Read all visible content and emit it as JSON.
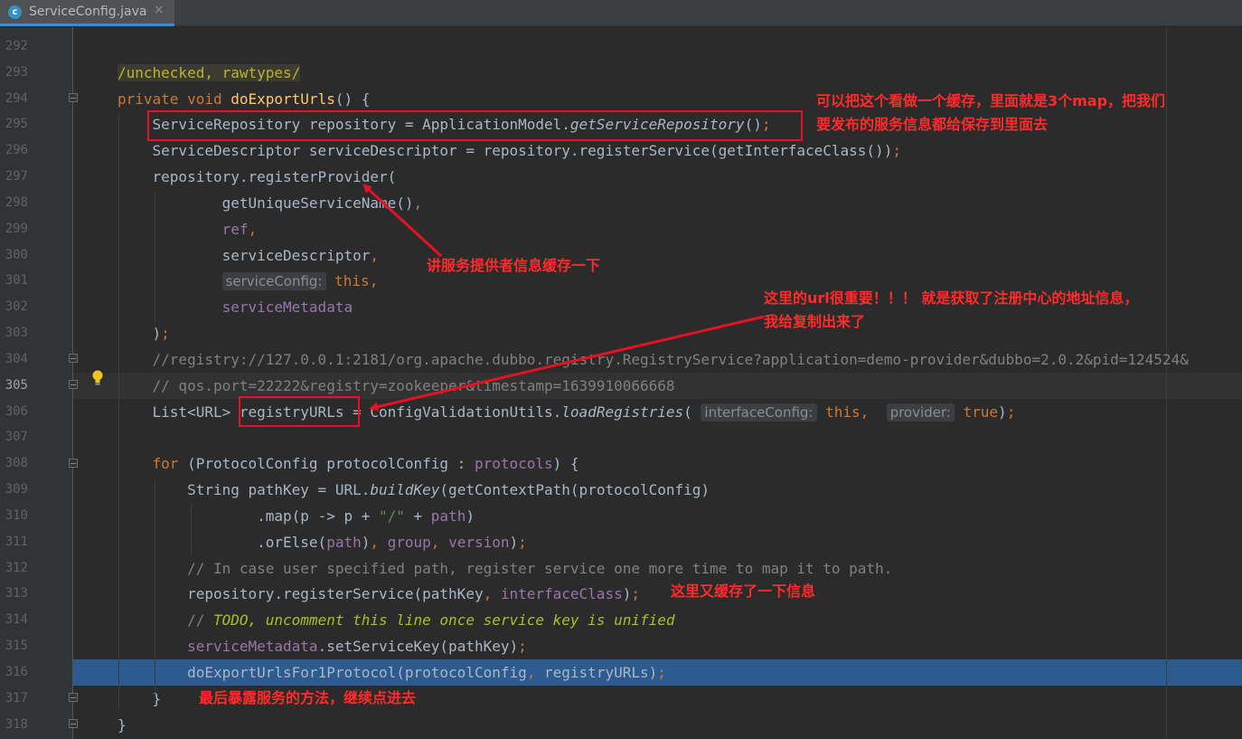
{
  "tab": {
    "icon_letter": "c",
    "name": "ServiceConfig.java",
    "close": "×"
  },
  "lines": [
    {
      "n": "292",
      "segs": []
    },
    {
      "n": "293",
      "segs": [
        {
          "t": "/unchecked, rawtypes/",
          "c": "ann ann-bg"
        }
      ]
    },
    {
      "n": "294",
      "segs": [
        {
          "t": "private void ",
          "c": "k"
        },
        {
          "t": "doExportUrls",
          "c": "m"
        },
        {
          "t": "() {"
        }
      ]
    },
    {
      "n": "295",
      "segs": [
        {
          "t": "    ServiceRepository repository = ApplicationModel."
        },
        {
          "t": "getServiceRepository",
          "c": "i"
        },
        {
          "t": "()"
        },
        {
          "t": ";",
          "c": "k"
        }
      ]
    },
    {
      "n": "296",
      "segs": [
        {
          "t": "    ServiceDescriptor serviceDescriptor = repository.registerService(getInterfaceClass())"
        },
        {
          "t": ";",
          "c": "k"
        }
      ]
    },
    {
      "n": "297",
      "segs": [
        {
          "t": "    repository.registerProvider("
        }
      ]
    },
    {
      "n": "298",
      "segs": [
        {
          "t": "            getUniqueServiceName()"
        },
        {
          "t": ",",
          "c": "k"
        }
      ]
    },
    {
      "n": "299",
      "segs": [
        {
          "t": "            "
        },
        {
          "t": "ref",
          "c": "f"
        },
        {
          "t": ",",
          "c": "k"
        }
      ]
    },
    {
      "n": "300",
      "segs": [
        {
          "t": "            serviceDescriptor"
        },
        {
          "t": ",",
          "c": "k"
        }
      ]
    },
    {
      "n": "301",
      "segs": [
        {
          "t": "            "
        },
        {
          "t": "serviceConfig:",
          "c": "hint"
        },
        {
          "t": " this",
          "c": "k"
        },
        {
          "t": ",",
          "c": "k"
        }
      ]
    },
    {
      "n": "302",
      "segs": [
        {
          "t": "            "
        },
        {
          "t": "serviceMetadata",
          "c": "f"
        }
      ]
    },
    {
      "n": "303",
      "segs": [
        {
          "t": "    )"
        },
        {
          "t": ";",
          "c": "k"
        }
      ]
    },
    {
      "n": "304",
      "segs": [
        {
          "t": "    //registry://127.0.0.1:2181/org.apache.dubbo.registry.RegistryService?application=demo-provider&dubbo=2.0.2&pid=124524&",
          "c": "c"
        }
      ]
    },
    {
      "n": "305",
      "segs": [
        {
          "t": "    // qos.port=22222&registry=zookeeper&timestamp=1639910066668",
          "c": "c"
        }
      ]
    },
    {
      "n": "306",
      "segs": [
        {
          "t": "    List<URL> registryURLs = ConfigValidationUtils."
        },
        {
          "t": "loadRegistries",
          "c": "i"
        },
        {
          "t": "( "
        },
        {
          "t": "interfaceConfig:",
          "c": "hint"
        },
        {
          "t": " this",
          "c": "k"
        },
        {
          "t": ",  ",
          "c": "k"
        },
        {
          "t": "provider:",
          "c": "hint"
        },
        {
          "t": " true",
          "c": "k"
        },
        {
          "t": ")"
        },
        {
          "t": ";",
          "c": "k"
        }
      ]
    },
    {
      "n": "307",
      "segs": []
    },
    {
      "n": "308",
      "segs": [
        {
          "t": "    "
        },
        {
          "t": "for ",
          "c": "k"
        },
        {
          "t": "(ProtocolConfig protocolConfig : "
        },
        {
          "t": "protocols",
          "c": "f"
        },
        {
          "t": ") {"
        }
      ]
    },
    {
      "n": "309",
      "segs": [
        {
          "t": "        String pathKey = URL."
        },
        {
          "t": "buildKey",
          "c": "i"
        },
        {
          "t": "(getContextPath(protocolConfig)"
        }
      ]
    },
    {
      "n": "310",
      "segs": [
        {
          "t": "                .map(p -> p + "
        },
        {
          "t": "\"/\"",
          "c": "s"
        },
        {
          "t": " + "
        },
        {
          "t": "path",
          "c": "f"
        },
        {
          "t": ")"
        }
      ]
    },
    {
      "n": "311",
      "segs": [
        {
          "t": "                .orElse("
        },
        {
          "t": "path",
          "c": "f"
        },
        {
          "t": ")"
        },
        {
          "t": ", ",
          "c": "k"
        },
        {
          "t": "group",
          "c": "f"
        },
        {
          "t": ", ",
          "c": "k"
        },
        {
          "t": "version",
          "c": "f"
        },
        {
          "t": ")"
        },
        {
          "t": ";",
          "c": "k"
        }
      ]
    },
    {
      "n": "312",
      "segs": [
        {
          "t": "        // In case user specified path, register service one more time to map it to path.",
          "c": "c"
        }
      ]
    },
    {
      "n": "313",
      "segs": [
        {
          "t": "        repository.registerService(pathKey"
        },
        {
          "t": ", ",
          "c": "k"
        },
        {
          "t": "interfaceClass",
          "c": "f"
        },
        {
          "t": ")"
        },
        {
          "t": ";",
          "c": "k"
        }
      ]
    },
    {
      "n": "314",
      "segs": [
        {
          "t": "        // ",
          "c": "c"
        },
        {
          "t": "TODO, uncomment this line once service key is unified",
          "c": "todo"
        }
      ]
    },
    {
      "n": "315",
      "segs": [
        {
          "t": "        "
        },
        {
          "t": "serviceMetadata",
          "c": "f"
        },
        {
          "t": ".setServiceKey(pathKey)"
        },
        {
          "t": ";",
          "c": "k"
        }
      ]
    },
    {
      "n": "316",
      "segs": [
        {
          "t": "        doExportUrlsFor1Protocol(protocolConfig"
        },
        {
          "t": ", ",
          "c": "k"
        },
        {
          "t": "registryURLs)"
        },
        {
          "t": ";",
          "c": "k"
        }
      ]
    },
    {
      "n": "317",
      "segs": [
        {
          "t": "    }"
        }
      ]
    },
    {
      "n": "318",
      "segs": [
        {
          "t": "}"
        }
      ]
    }
  ],
  "notes": {
    "cache_line1": "可以把这个看做一个缓存，里面就是3个map，把我们",
    "cache_line2": "要发布的服务信息都给保存到里面去",
    "provider": "讲服务提供者信息缓存一下",
    "url_line1": "这里的url很重要！！！ 就是获取了注册中心的地址信息，",
    "url_line2": "我给复制出来了",
    "again": "这里又缓存了一下信息",
    "export": "最后暴露服务的方法，继续点进去"
  },
  "colors": {
    "annotation": "#e81123",
    "exec_line": "#2d5b8f",
    "keyword": "#cc7832"
  }
}
